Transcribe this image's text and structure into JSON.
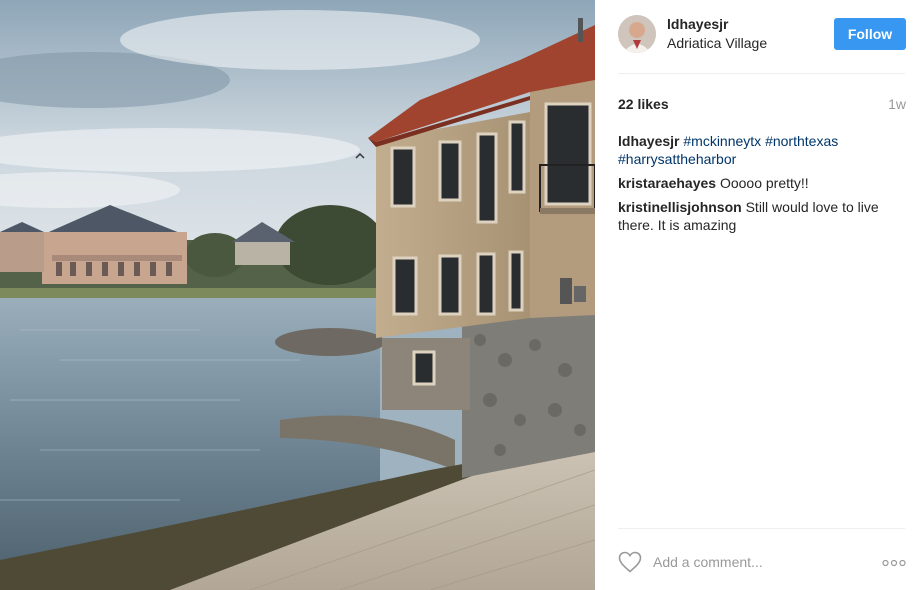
{
  "post": {
    "username": "ldhayesjr",
    "location": "Adriatica Village",
    "follow_label": "Follow",
    "likes": "22 likes",
    "timestamp": "1w",
    "caption": {
      "author": "ldhayesjr",
      "hashtags": [
        "#mckinneytx",
        "#northtexas",
        "#harrysattheharbor"
      ]
    },
    "comments": [
      {
        "author": "kristaraehayes",
        "text": "Ooooo pretty!!"
      },
      {
        "author": "kristinellisjohnson",
        "text": "Still would love to live there. It is amazing"
      }
    ]
  },
  "footer": {
    "comment_placeholder": "Add a comment...",
    "like_icon": "heart-outline-icon",
    "more_icon": "more-options-icon"
  },
  "colors": {
    "follow_button": "#3897f0",
    "hashtag": "#003569",
    "muted_text": "#999999",
    "divider": "#efefef"
  }
}
